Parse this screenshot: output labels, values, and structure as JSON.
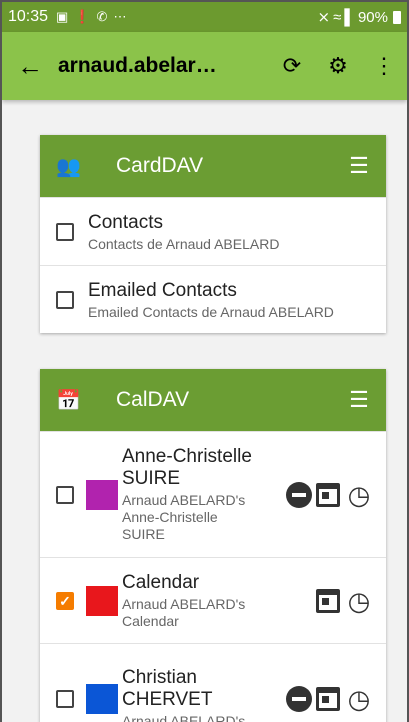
{
  "statusbar": {
    "time": "10:35",
    "icons": [
      "image-icon",
      "alert-icon",
      "whatsapp-icon",
      "more-icon"
    ],
    "battery": "90%"
  },
  "appbar": {
    "title": "arnaud.abelar…"
  },
  "carddav": {
    "title": "CardDAV",
    "items": [
      {
        "name": "Contacts",
        "desc": "Contacts de Arnaud ABELARD",
        "checked": false
      },
      {
        "name": "Emailed Contacts",
        "desc": "Emailed Contacts de Arnaud ABELARD",
        "checked": false
      }
    ]
  },
  "caldav": {
    "title": "CalDAV",
    "items": [
      {
        "name": "Anne-Christelle SUIRE",
        "desc": "Arnaud ABELARD's Anne-Christelle SUIRE",
        "color": "#b123ae",
        "checked": false,
        "readonly": true
      },
      {
        "name": "Calendar",
        "desc": "Arnaud ABELARD's Calendar",
        "color": "#e8171c",
        "checked": true,
        "readonly": false
      },
      {
        "name": "Christian CHERVET",
        "desc": "Arnaud ABELARD's",
        "color": "#0b56d6",
        "checked": false,
        "readonly": true
      }
    ]
  },
  "colors": {
    "statusbar": "#6c9a2f",
    "appbar": "#8bc34a",
    "card_header": "#6b9d33",
    "checkbox_checked": "#f57c00"
  }
}
